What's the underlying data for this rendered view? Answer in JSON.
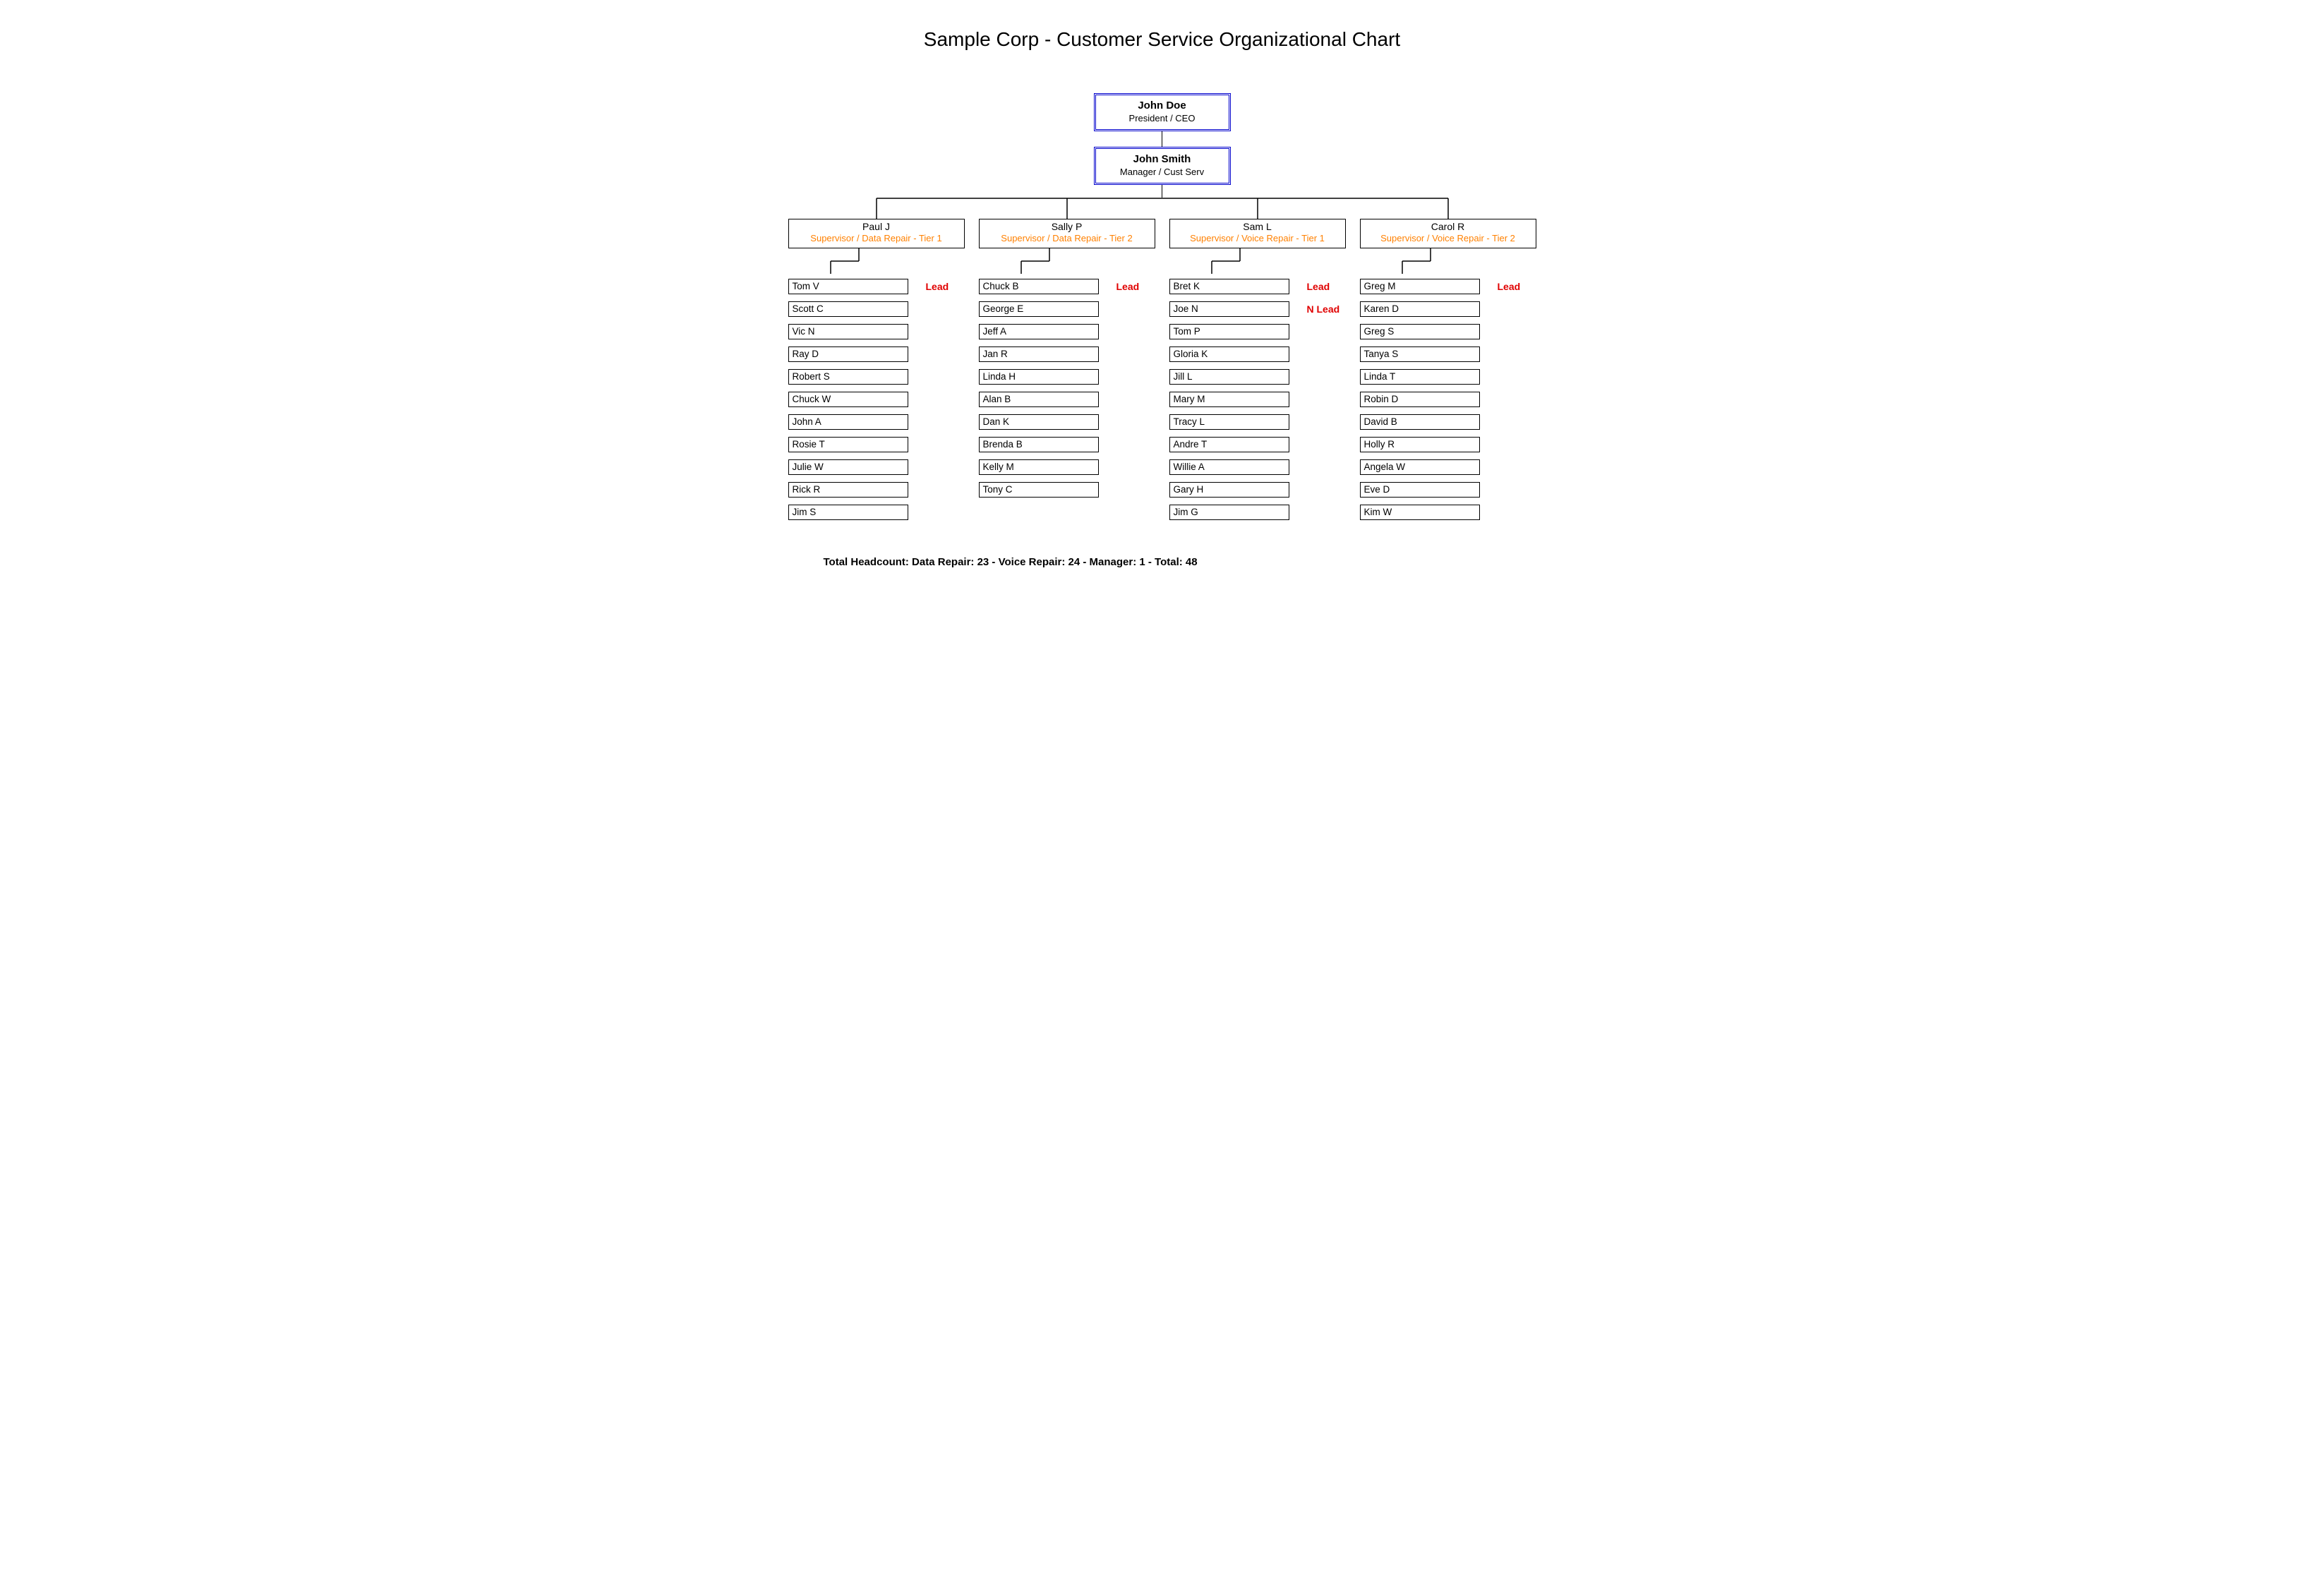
{
  "title": "Sample Corp - Customer Service Organizational Chart",
  "exec1": {
    "name": "John Doe",
    "role": "President / CEO"
  },
  "exec2": {
    "name": "John Smith",
    "role": "Manager / Cust Serv"
  },
  "columns": [
    {
      "supervisor": {
        "name": "Paul J",
        "role": "Supervisor / Data Repair - Tier 1"
      },
      "members": [
        {
          "name": "Tom V",
          "tag": "Lead"
        },
        {
          "name": "Scott C",
          "tag": ""
        },
        {
          "name": "Vic N",
          "tag": ""
        },
        {
          "name": "Ray D",
          "tag": ""
        },
        {
          "name": "Robert S",
          "tag": ""
        },
        {
          "name": "Chuck W",
          "tag": ""
        },
        {
          "name": "John A",
          "tag": ""
        },
        {
          "name": "Rosie T",
          "tag": ""
        },
        {
          "name": "Julie W",
          "tag": ""
        },
        {
          "name": "Rick R",
          "tag": ""
        },
        {
          "name": "Jim S",
          "tag": ""
        }
      ]
    },
    {
      "supervisor": {
        "name": "Sally P",
        "role": "Supervisor / Data Repair - Tier 2"
      },
      "members": [
        {
          "name": "Chuck B",
          "tag": "Lead"
        },
        {
          "name": "George E",
          "tag": ""
        },
        {
          "name": "Jeff A",
          "tag": ""
        },
        {
          "name": "Jan R",
          "tag": ""
        },
        {
          "name": "Linda H",
          "tag": ""
        },
        {
          "name": "Alan B",
          "tag": ""
        },
        {
          "name": "Dan K",
          "tag": ""
        },
        {
          "name": "Brenda B",
          "tag": ""
        },
        {
          "name": "Kelly M",
          "tag": ""
        },
        {
          "name": "Tony C",
          "tag": ""
        }
      ]
    },
    {
      "supervisor": {
        "name": "Sam L",
        "role": "Supervisor / Voice Repair - Tier 1"
      },
      "members": [
        {
          "name": "Bret K",
          "tag": "Lead"
        },
        {
          "name": "Joe N",
          "tag": "N Lead"
        },
        {
          "name": "Tom P",
          "tag": ""
        },
        {
          "name": "Gloria K",
          "tag": ""
        },
        {
          "name": "Jill L",
          "tag": ""
        },
        {
          "name": "Mary M",
          "tag": ""
        },
        {
          "name": "Tracy L",
          "tag": ""
        },
        {
          "name": "Andre T",
          "tag": ""
        },
        {
          "name": "Willie A",
          "tag": ""
        },
        {
          "name": "Gary H",
          "tag": ""
        },
        {
          "name": "Jim G",
          "tag": ""
        }
      ]
    },
    {
      "supervisor": {
        "name": "Carol R",
        "role": "Supervisor / Voice Repair - Tier 2"
      },
      "members": [
        {
          "name": "Greg M",
          "tag": "Lead"
        },
        {
          "name": "Karen D",
          "tag": ""
        },
        {
          "name": "Greg S",
          "tag": ""
        },
        {
          "name": "Tanya S",
          "tag": ""
        },
        {
          "name": "Linda T",
          "tag": ""
        },
        {
          "name": "Robin D",
          "tag": ""
        },
        {
          "name": "David B",
          "tag": ""
        },
        {
          "name": "Holly R",
          "tag": ""
        },
        {
          "name": "Angela W",
          "tag": ""
        },
        {
          "name": "Eve D",
          "tag": ""
        },
        {
          "name": "Kim W",
          "tag": ""
        }
      ]
    }
  ],
  "footer": "Total Headcount:  Data Repair: 23  -  Voice Repair: 24  -  Manager: 1  -   Total: 48"
}
